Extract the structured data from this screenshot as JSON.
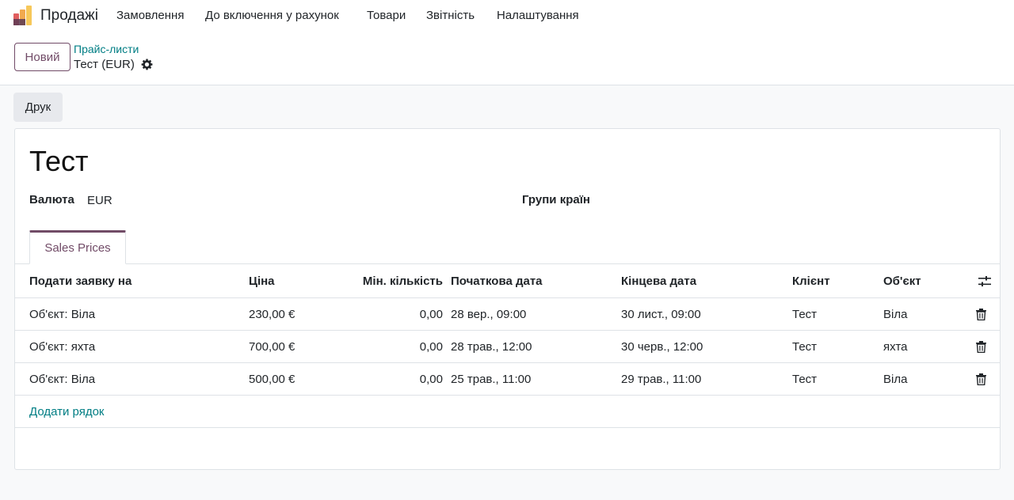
{
  "app": {
    "name": "Продажі",
    "menu": [
      "Замовлення",
      "До включення у рахунок",
      "Товари",
      "Звітність",
      "Налаштування"
    ]
  },
  "control": {
    "new_label": "Новий",
    "breadcrumb": "Прайс-листи",
    "record": "Тест (EUR)"
  },
  "actions": {
    "print_label": "Друк"
  },
  "form": {
    "title": "Тест",
    "currency_label": "Валюта",
    "currency_value": "EUR",
    "country_groups_label": "Групи країн"
  },
  "tabs": [
    {
      "label": "Sales Prices",
      "active": true
    }
  ],
  "table": {
    "columns": [
      "Подати заявку на",
      "Ціна",
      "Мін. кількість",
      "Початкова дата",
      "Кінцева дата",
      "Клієнт",
      "Об'єкт"
    ],
    "rows": [
      [
        "Об'єкт: Віла",
        "230,00 €",
        "0,00",
        "28 вер., 09:00",
        "30 лист., 09:00",
        "Тест",
        "Віла"
      ],
      [
        "Об'єкт: яхта",
        "700,00 €",
        "0,00",
        "28 трав., 12:00",
        "30 черв., 12:00",
        "Тест",
        "яхта"
      ],
      [
        "Об'єкт: Віла",
        "500,00 €",
        "0,00",
        "25 трав., 11:00",
        "29 трав., 11:00",
        "Тест",
        "Віла"
      ]
    ],
    "add_line": "Додати рядок"
  },
  "colors": {
    "primary": "#714b67",
    "link": "#017e84",
    "border": "#dee2e6"
  },
  "icons": [
    "sales-app-logo",
    "gear-icon",
    "trash-icon",
    "column-settings-icon"
  ]
}
